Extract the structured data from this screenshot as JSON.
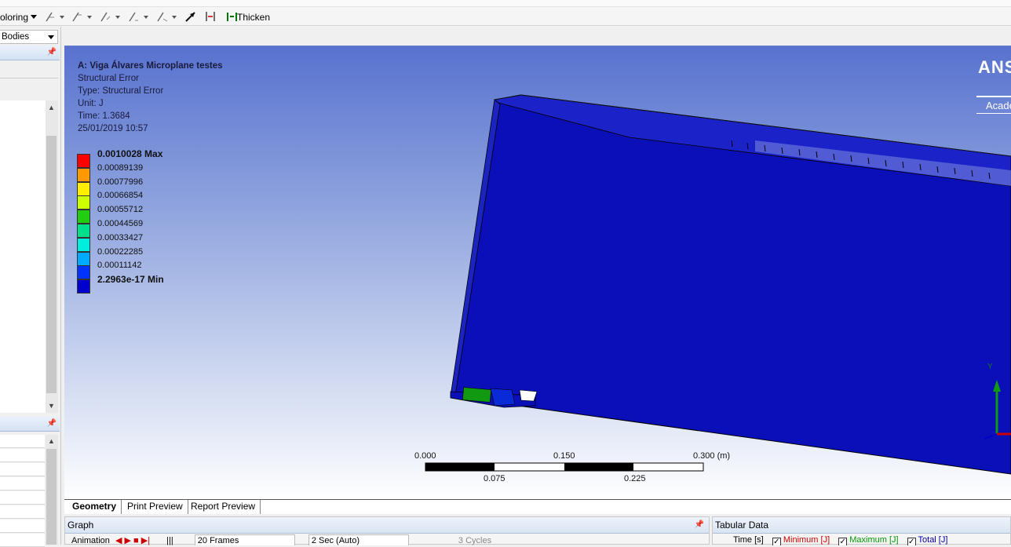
{
  "toolbar": {
    "coloring_label": "oloring",
    "thicken_label": "Thicken"
  },
  "left_panel": {
    "filter_combo": "Bodies"
  },
  "viewport": {
    "info": {
      "title": "A: Viga Álvares Microplane testes",
      "result": "Structural Error",
      "type": "Type: Structural Error",
      "unit": "Unit: J",
      "time": "Time: 1.3684",
      "date": "25/01/2019 10:57"
    },
    "legend": [
      {
        "value": "0.0010028 Max",
        "color": "#ff0000",
        "bold": true
      },
      {
        "value": "0.00089139",
        "color": "#ff9900"
      },
      {
        "value": "0.00077996",
        "color": "#ffee00"
      },
      {
        "value": "0.00066854",
        "color": "#ccff00"
      },
      {
        "value": "0.00055712",
        "color": "#22cc11"
      },
      {
        "value": "0.00044569",
        "color": "#00e08a"
      },
      {
        "value": "0.00033427",
        "color": "#00eedd"
      },
      {
        "value": "0.00022285",
        "color": "#00aaff"
      },
      {
        "value": "0.00011142",
        "color": "#0033ff"
      },
      {
        "value": "2.2963e-17 Min",
        "color": "#0000cc",
        "bold": true
      }
    ],
    "brand": "ANSYS",
    "brand_sub": "Academic",
    "scale": {
      "top_labels": [
        "0.000",
        "0.150",
        "0.300 (m)"
      ],
      "bottom_labels": [
        "0.075",
        "0.225"
      ]
    },
    "axis_y_label": "Y"
  },
  "tabs": [
    "Geometry",
    "Print Preview",
    "Report Preview"
  ],
  "graph_panel": {
    "title": "Graph",
    "animation_label": "Animation",
    "frames": "20 Frames",
    "duration": "2 Sec (Auto)",
    "cycles": "3 Cycles"
  },
  "tabular_panel": {
    "title": "Tabular Data",
    "columns": [
      "Time [s]",
      "Minimum [J]",
      "Maximum [J]",
      "Total [J]"
    ],
    "column_colors": [
      "#000000",
      "#cc0000",
      "#009900",
      "#0000aa"
    ]
  }
}
